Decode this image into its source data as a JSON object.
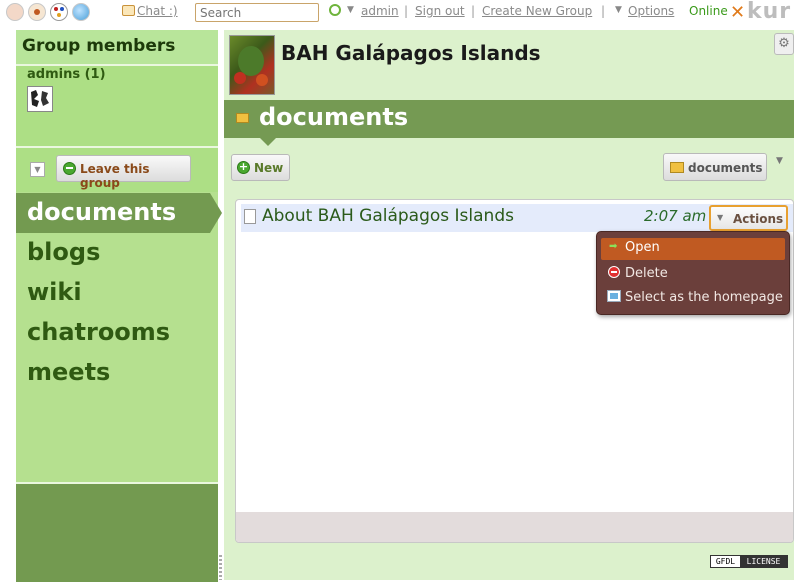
{
  "topbar": {
    "chat_label": "Chat :)",
    "search_placeholder": "Search",
    "user_label": "admin",
    "signout_label": "Sign out",
    "create_group_label": "Create New Group",
    "options_label": "Options",
    "online_label": "Online",
    "logo_text": "kur",
    "separator": "|"
  },
  "sidebar": {
    "members_heading": "Group members",
    "admins_label": "admins (1)",
    "leave_label": "Leave this group",
    "nav": [
      {
        "label": "documents",
        "active": true
      },
      {
        "label": "blogs"
      },
      {
        "label": "wiki"
      },
      {
        "label": "chatrooms"
      },
      {
        "label": "meets"
      }
    ]
  },
  "group": {
    "title": "BAH Galápagos Islands",
    "section_title": "documents"
  },
  "toolbar": {
    "new_label": "New",
    "folder_label": "documents"
  },
  "documents": [
    {
      "title": "About BAH Galápagos Islands",
      "time": "2:07 am",
      "actions_label": "Actions"
    }
  ],
  "actions_menu": {
    "items": [
      {
        "label": "Open",
        "icon": "arrow-right-icon",
        "highlighted": true
      },
      {
        "label": "Delete",
        "icon": "delete-icon"
      },
      {
        "label": "Select as the homepage",
        "icon": "homepage-icon"
      }
    ]
  },
  "footer": {
    "license_left": "GFDL",
    "license_right": "LICENSE"
  },
  "colors": {
    "sidebar_bg": "#b5e08f",
    "active_nav": "#739a50",
    "section_bar": "#759a53",
    "menu_bg": "#6b3f3b",
    "menu_highlight": "#c05a22",
    "actions_border": "#e8a030"
  }
}
